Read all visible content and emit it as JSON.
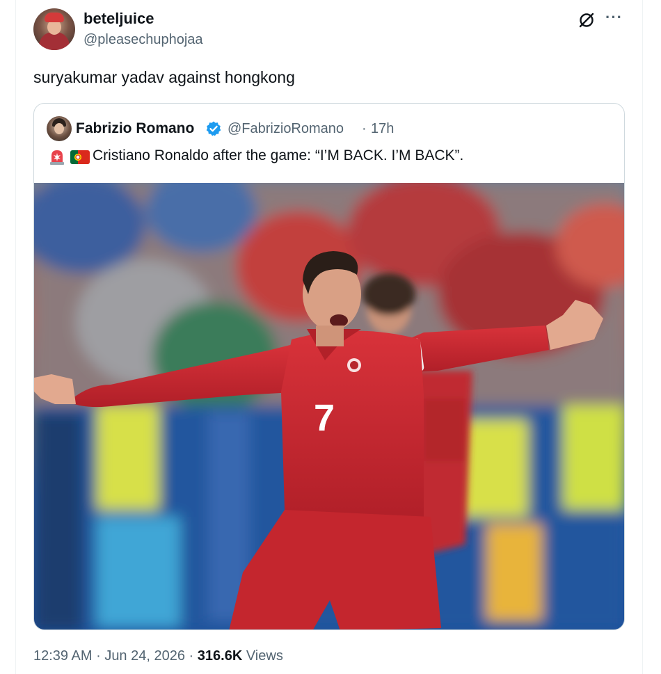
{
  "author": {
    "display_name": "beteljuice",
    "handle": "@pleasechuphojaa"
  },
  "tweet": {
    "text": "suryakumar yadav against hongkong"
  },
  "quoted": {
    "display_name": "Fabrizio Romano",
    "handle": "@FabrizioRomano",
    "separator": "·",
    "time": "17h",
    "text": "Cristiano Ronaldo after the game: “I’M BACK. I’M BACK”.",
    "icons": [
      "siren-icon",
      "portugal-flag-icon",
      "verified-icon"
    ],
    "photo": {
      "jersey_number": "7"
    }
  },
  "meta": {
    "time": "12:39 AM",
    "sep1": "·",
    "date": "Jun 24, 2026",
    "sep2": "·",
    "views_count": "316.6K",
    "views_label": "Views"
  },
  "colors": {
    "text_primary": "#0f1419",
    "text_secondary": "#536471",
    "verified_blue": "#1d9bf0",
    "border": "#cfd9de",
    "jersey_red": "#c8262c"
  },
  "header_icons": [
    "grok-icon",
    "more-icon"
  ]
}
